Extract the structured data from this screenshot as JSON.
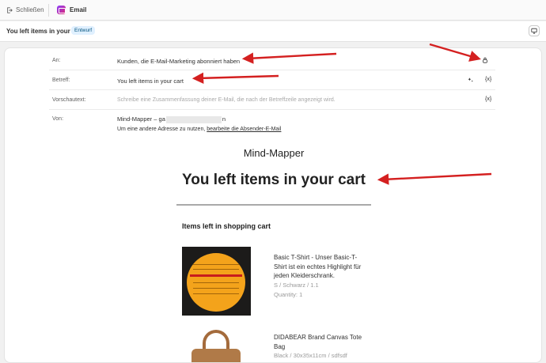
{
  "topbar": {
    "close_label": "Schließen",
    "app_tab_label": "Email"
  },
  "titlebar": {
    "title": "You left items in your cart",
    "status_badge": "Entwurf"
  },
  "form": {
    "to": {
      "label": "An:",
      "value": "Kunden, die E-Mail-Marketing abonniert haben"
    },
    "subject": {
      "label": "Betreff:",
      "value": "You left items in your cart"
    },
    "preview": {
      "label": "Vorschautext:",
      "placeholder": "Schreibe eine Zusammenfassung deiner E-Mail, die nach der Betreffzeile angezeigt wird."
    },
    "from": {
      "label": "Von:",
      "name_prefix": "Mind-Mapper – ga",
      "name_suffix": "n",
      "hint_prefix": "Um eine andere Adresse zu nutzen,",
      "hint_link": "bearbeite die Absender-E-Mail"
    },
    "variable_icon_label": "{x}"
  },
  "email": {
    "brand": "Mind-Mapper",
    "headline": "You left items in your cart",
    "section_title": "Items left in shopping cart",
    "products": [
      {
        "name": "Basic T-Shirt - Unser Basic-T-Shirt ist ein echtes Highlight für jeden Kleiderschrank.",
        "variant": "S / Schwarz / 1.1",
        "quantity": "Quantity: 1",
        "image_icon": "sticker-photo"
      },
      {
        "name": "DIDABEAR Brand Canvas Tote Bag",
        "variant": "Black / 30x35x11cm / sdfsdf",
        "quantity": "",
        "image_icon": "bag-photo"
      }
    ]
  },
  "colors": {
    "annotation_arrow": "#d42020",
    "badge_bg": "#e0f0ff",
    "badge_text": "#00527c"
  }
}
